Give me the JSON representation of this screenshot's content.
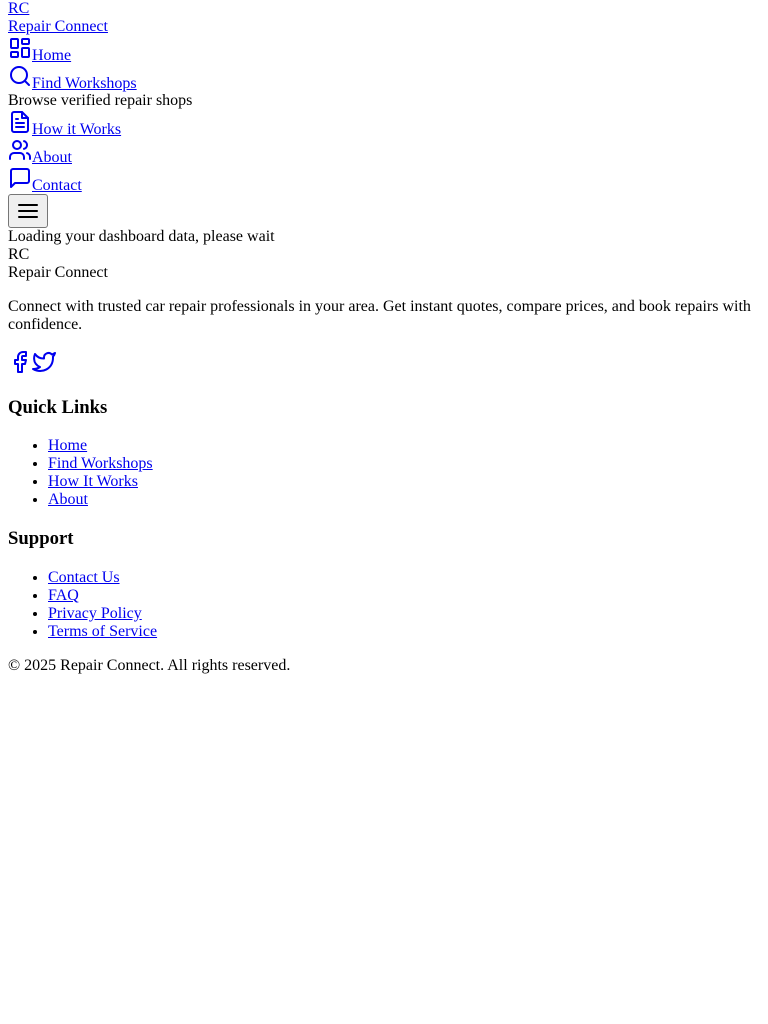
{
  "header": {
    "logo_initials": "RC",
    "logo_name": "Repair Connect",
    "nav": [
      {
        "label": "Home",
        "icon": "dashboard-grid-icon"
      },
      {
        "label": "Find Workshops",
        "icon": "search-icon",
        "description": "Browse verified repair shops"
      },
      {
        "label": "How it Works",
        "icon": "document-icon"
      },
      {
        "label": "About",
        "icon": "users-icon"
      },
      {
        "label": "Contact",
        "icon": "message-icon"
      }
    ]
  },
  "main": {
    "loading_text": "Loading your dashboard data, please wait"
  },
  "footer": {
    "logo_initials": "RC",
    "logo_name": "Repair Connect",
    "tagline": "Connect with trusted car repair professionals in your area. Get instant quotes, compare prices, and book repairs with confidence.",
    "quick_links": {
      "heading": "Quick Links",
      "items": [
        "Home",
        "Find Workshops",
        "How It Works",
        "About"
      ]
    },
    "support": {
      "heading": "Support",
      "items": [
        "Contact Us",
        "FAQ",
        "Privacy Policy",
        "Terms of Service"
      ]
    },
    "copyright": "© 2025 Repair Connect. All rights reserved."
  },
  "colors": {
    "link": "#0000ee",
    "text": "#000000"
  }
}
